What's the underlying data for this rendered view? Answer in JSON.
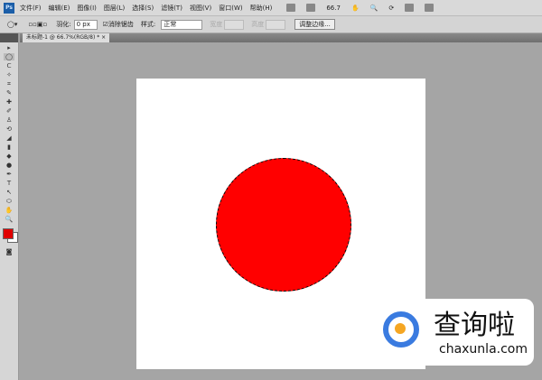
{
  "menu": [
    "文件(F)",
    "编辑(E)",
    "图像(I)",
    "图层(L)",
    "选择(S)",
    "滤镜(T)",
    "视图(V)",
    "窗口(W)",
    "帮助(H)"
  ],
  "app_logo": "Ps",
  "zoom_level": "66.7",
  "options": {
    "feather_label": "羽化:",
    "feather_value": "0 px",
    "antialias_label": "消除锯齿",
    "style_label": "样式:",
    "style_value": "正常",
    "width_label": "宽度",
    "height_label": "高度",
    "refine_button": "调整边缘..."
  },
  "document_tab": "未标题-1 @ 66.7%(RGB/8) *",
  "tools": [
    "▸",
    "◯",
    "ᑕ",
    "✧",
    "⌗",
    "✎",
    "✚",
    "✐",
    "♙",
    "⟲",
    "◢",
    "▮",
    "◆",
    "●",
    "✒",
    "T",
    "↖",
    "⬭",
    "✋",
    "🔍"
  ],
  "colors": {
    "foreground": "#e00000",
    "background": "#ffffff",
    "shape": "#ff0000"
  },
  "watermark": {
    "cn": "查询啦",
    "en": "chaxunla.com"
  }
}
